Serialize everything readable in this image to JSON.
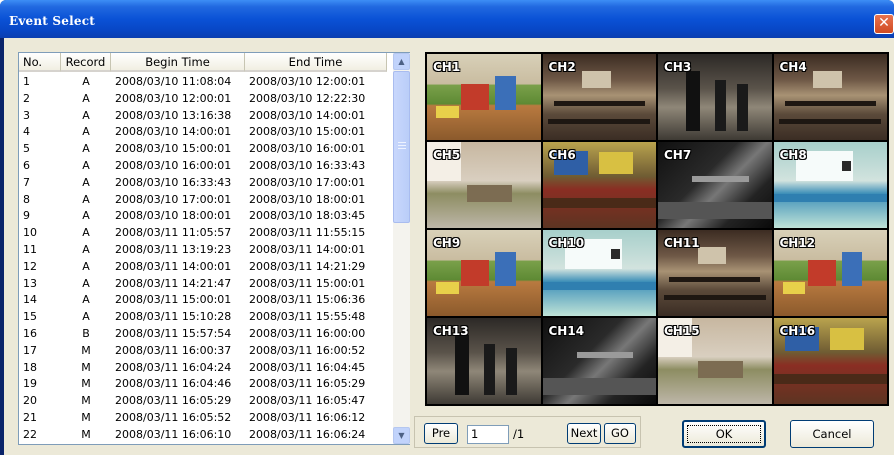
{
  "window": {
    "title": "Event Select",
    "close_label": "✕"
  },
  "table": {
    "columns": [
      "No.",
      "Record",
      "Begin Time",
      "End Time"
    ],
    "rows": [
      [
        "1",
        "A",
        "2008/03/10 11:08:04",
        "2008/03/10 12:00:01"
      ],
      [
        "2",
        "A",
        "2008/03/10 12:00:01",
        "2008/03/10 12:22:30"
      ],
      [
        "3",
        "A",
        "2008/03/10 13:16:38",
        "2008/03/10 14:00:01"
      ],
      [
        "4",
        "A",
        "2008/03/10 14:00:01",
        "2008/03/10 15:00:01"
      ],
      [
        "5",
        "A",
        "2008/03/10 15:00:01",
        "2008/03/10 16:00:01"
      ],
      [
        "6",
        "A",
        "2008/03/10 16:00:01",
        "2008/03/10 16:33:43"
      ],
      [
        "7",
        "A",
        "2008/03/10 16:33:43",
        "2008/03/10 17:00:01"
      ],
      [
        "8",
        "A",
        "2008/03/10 17:00:01",
        "2008/03/10 18:00:01"
      ],
      [
        "9",
        "A",
        "2008/03/10 18:00:01",
        "2008/03/10 18:03:45"
      ],
      [
        "10",
        "A",
        "2008/03/11 11:05:57",
        "2008/03/11 11:55:15"
      ],
      [
        "11",
        "A",
        "2008/03/11 13:19:23",
        "2008/03/11 14:00:01"
      ],
      [
        "12",
        "A",
        "2008/03/11 14:00:01",
        "2008/03/11 14:21:29"
      ],
      [
        "13",
        "A",
        "2008/03/11 14:21:47",
        "2008/03/11 15:00:01"
      ],
      [
        "14",
        "A",
        "2008/03/11 15:00:01",
        "2008/03/11 15:06:36"
      ],
      [
        "15",
        "A",
        "2008/03/11 15:10:28",
        "2008/03/11 15:55:48"
      ],
      [
        "16",
        "B",
        "2008/03/11 15:57:54",
        "2008/03/11 16:00:00"
      ],
      [
        "17",
        "M",
        "2008/03/11 16:00:37",
        "2008/03/11 16:00:52"
      ],
      [
        "18",
        "M",
        "2008/03/11 16:04:24",
        "2008/03/11 16:04:45"
      ],
      [
        "19",
        "M",
        "2008/03/11 16:04:46",
        "2008/03/11 16:05:29"
      ],
      [
        "20",
        "M",
        "2008/03/11 16:05:29",
        "2008/03/11 16:05:47"
      ],
      [
        "21",
        "M",
        "2008/03/11 16:05:52",
        "2008/03/11 16:06:12"
      ],
      [
        "22",
        "M",
        "2008/03/11 16:06:10",
        "2008/03/11 16:06:24"
      ]
    ]
  },
  "cameras": [
    {
      "label": "CH1",
      "scene": "s-kids"
    },
    {
      "label": "CH2",
      "scene": "s-class"
    },
    {
      "label": "CH3",
      "scene": "s-hall"
    },
    {
      "label": "CH4",
      "scene": "s-class"
    },
    {
      "label": "CH5",
      "scene": "s-room"
    },
    {
      "label": "CH6",
      "scene": "s-arts"
    },
    {
      "label": "CH7",
      "scene": "s-dark"
    },
    {
      "label": "CH8",
      "scene": "s-lab"
    },
    {
      "label": "CH9",
      "scene": "s-kids"
    },
    {
      "label": "CH10",
      "scene": "s-lab"
    },
    {
      "label": "CH11",
      "scene": "s-class"
    },
    {
      "label": "CH12",
      "scene": "s-kids"
    },
    {
      "label": "CH13",
      "scene": "s-hall"
    },
    {
      "label": "CH14",
      "scene": "s-dark"
    },
    {
      "label": "CH15",
      "scene": "s-room"
    },
    {
      "label": "CH16",
      "scene": "s-arts"
    }
  ],
  "pager": {
    "pre_label": "Pre",
    "page_value": "1",
    "page_total": "/1",
    "next_label": "Next",
    "go_label": "GO"
  },
  "actions": {
    "ok_label": "OK",
    "cancel_label": "Cancel"
  },
  "colors": {
    "titlebar": "#0a52d6",
    "dialog_bg": "#ece9d8",
    "close": "#d04a22"
  }
}
